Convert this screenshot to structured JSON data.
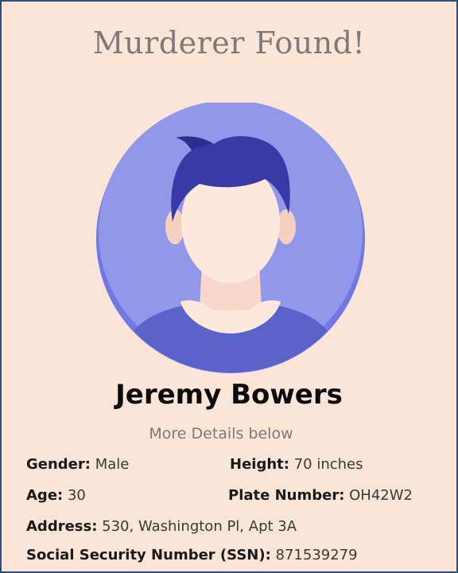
{
  "page": {
    "title": "Murderer Found!",
    "suspect_name": "Jeremy Bowers",
    "subtitle": "More Details below"
  },
  "avatar": {
    "icon": "person-avatar-icon"
  },
  "details": {
    "gender": {
      "label": "Gender",
      "value": "Male"
    },
    "height": {
      "label": "Height",
      "value": "70 inches"
    },
    "age": {
      "label": "Age",
      "value": "30"
    },
    "plate": {
      "label": "Plate Number",
      "value": "OH42W2"
    },
    "address": {
      "label": "Address",
      "value": "530, Washington Pl, Apt 3A"
    },
    "ssn": {
      "label": "Social Security Number (SSN)",
      "value": "871539279"
    }
  },
  "colors": {
    "background": "#fbe5d6",
    "border": "#2f4f7f",
    "avatar_circle": "#8c93e6",
    "hair": "#3a3aa6",
    "shirt": "#5a63c9",
    "skin": "#fde9dc"
  }
}
